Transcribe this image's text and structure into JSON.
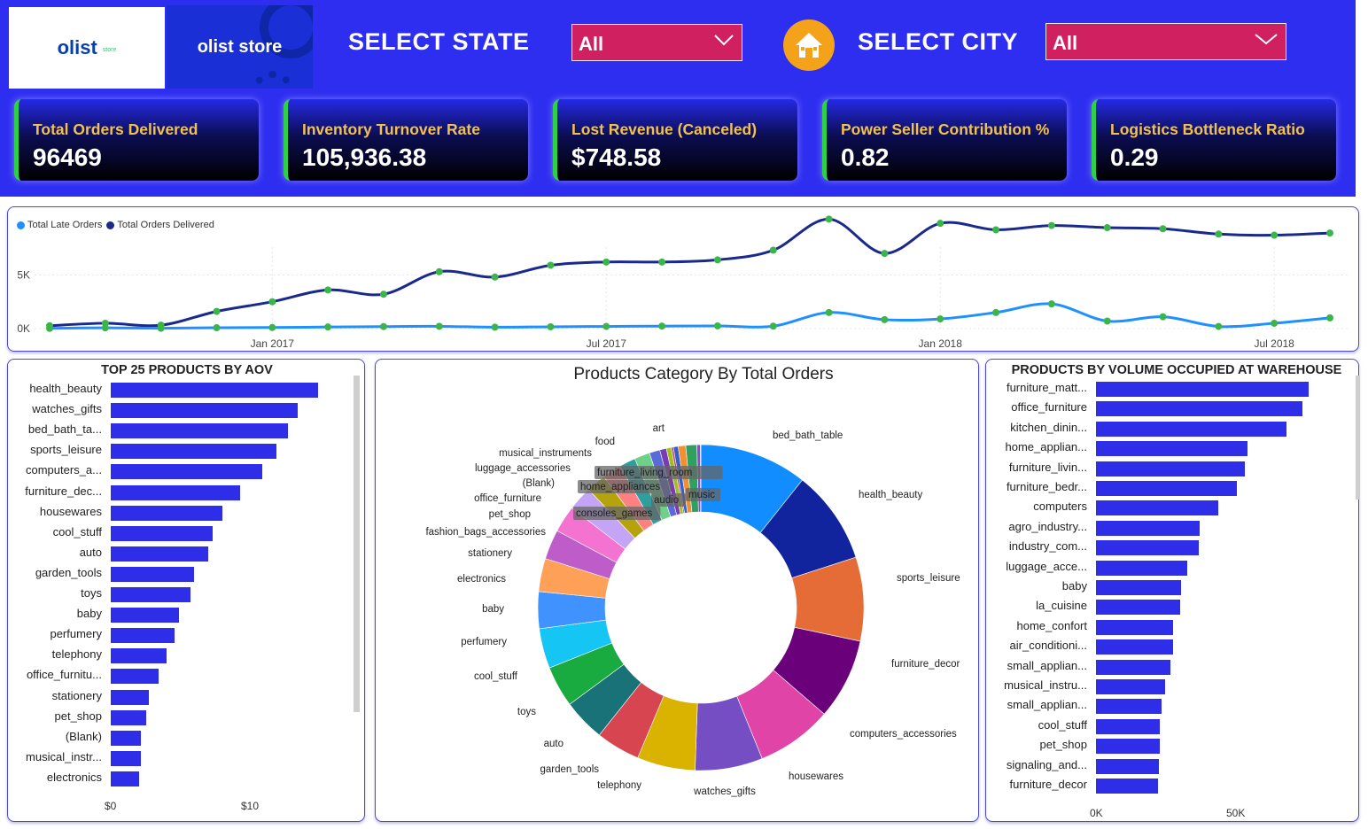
{
  "logos": {
    "olist": "olist",
    "olist_tag": "store",
    "olist_store": "olist store"
  },
  "filters": {
    "state_label": "SELECT STATE",
    "state_value": "All",
    "city_label": "SELECT CITY",
    "city_value": "All"
  },
  "kpis": [
    {
      "title": "Total Orders Delivered",
      "value": "96469"
    },
    {
      "title": "Inventory Turnover Rate",
      "value": "105,936.38"
    },
    {
      "title": "Lost Revenue (Canceled)",
      "value": "$748.58"
    },
    {
      "title": "Power Seller Contribution %",
      "value": "0.82"
    },
    {
      "title": "Logistics Bottleneck Ratio",
      "value": "0.29"
    }
  ],
  "colors": {
    "header": "#2e2ef0",
    "bar": "#2e2ee8",
    "late": "#1e90ff",
    "delivered": "#1a2a8c",
    "marker": "#3bb54a"
  },
  "chart_data": [
    {
      "type": "line",
      "legend": [
        "Total Late Orders",
        "Total Orders Delivered"
      ],
      "x": [
        "2016-10",
        "2016-12",
        "2017-01",
        "2017-02",
        "2017-03",
        "2017-04",
        "2017-05",
        "2017-06",
        "2017-07",
        "2017-08",
        "2017-09",
        "2017-10",
        "2017-11",
        "2017-12",
        "2018-01",
        "2018-02",
        "2018-03",
        "2018-04",
        "2018-05",
        "2018-06",
        "2018-07",
        "2018-08"
      ],
      "x_ticks": [
        "Jan 2017",
        "Jul 2017",
        "Jan 2018",
        "Jul 2018"
      ],
      "y_ticks": [
        "0K",
        "5K"
      ],
      "ylim": [
        0,
        8000
      ],
      "series": [
        {
          "name": "Total Orders Delivered",
          "values": [
            265,
            500,
            320,
            1600,
            2500,
            3600,
            3200,
            5300,
            4800,
            5900,
            6200,
            6200,
            6400,
            7300,
            10200,
            7000,
            9800,
            9200,
            9600,
            9400,
            9300,
            8800,
            8700,
            8900
          ]
        },
        {
          "name": "Total Late Orders",
          "values": [
            20,
            70,
            30,
            80,
            100,
            150,
            190,
            210,
            130,
            170,
            200,
            230,
            250,
            230,
            1500,
            830,
            900,
            1500,
            2300,
            700,
            1100,
            200,
            500,
            1000
          ]
        }
      ]
    },
    {
      "type": "bar",
      "title": "TOP 25 PRODUCTS BY AOV",
      "categories": [
        "health_beauty",
        "watches_gifts",
        "bed_bath_ta...",
        "sports_leisure",
        "computers_a...",
        "furniture_dec...",
        "housewares",
        "cool_stuff",
        "auto",
        "garden_tools",
        "toys",
        "baby",
        "perfumery",
        "telephony",
        "office_furnitu...",
        "stationery",
        "pet_shop",
        "(Blank)",
        "musical_instr...",
        "electronics"
      ],
      "values": [
        13.0,
        11.7,
        11.1,
        10.4,
        9.5,
        8.1,
        7.0,
        6.4,
        6.1,
        5.2,
        5.0,
        4.3,
        4.0,
        3.5,
        3.0,
        2.4,
        2.2,
        1.9,
        1.9,
        1.8
      ],
      "x_ticks": [
        "$0",
        "$10"
      ],
      "xlim": [
        0,
        15
      ]
    },
    {
      "type": "pie",
      "title": "Products Category By Total Orders",
      "labels": [
        "bed_bath_table",
        "health_beauty",
        "sports_leisure",
        "furniture_decor",
        "computers_accessories",
        "housewares",
        "watches_gifts",
        "telephony",
        "garden_tools",
        "auto",
        "toys",
        "cool_stuff",
        "perfumery",
        "baby",
        "electronics",
        "stationery",
        "fashion_bags_accessories",
        "pet_shop",
        "office_furniture",
        "(Blank)",
        "luggage_accessories",
        "musical_instruments",
        "food",
        "art",
        "furniture_living_room",
        "home_appliances",
        "consoles_games",
        "audio",
        "music"
      ],
      "values": [
        11115,
        9670,
        8641,
        8334,
        7827,
        6964,
        5991,
        4545,
        4347,
        4235,
        4117,
        3796,
        3419,
        3065,
        2767,
        2517,
        2031,
        1947,
        1691,
        1603,
        1092,
        680,
        510,
        209,
        503,
        771,
        1137,
        364,
        38
      ],
      "colors": [
        "#118dff",
        "#12239e",
        "#e66c37",
        "#6b007b",
        "#e044a7",
        "#744ec2",
        "#d9b300",
        "#d64550",
        "#197278",
        "#1aab40",
        "#15c6f4",
        "#4092ff",
        "#ffa058",
        "#be5dc9",
        "#f472d0",
        "#c4a5f5",
        "#b5a30e",
        "#ff8080",
        "#2f9e9e",
        "#6fd08a",
        "#5a6ad8",
        "#7a3bb5",
        "#a0c020",
        "#c83a72",
        "#3060c8",
        "#f09030",
        "#30a060",
        "#8050d0",
        "#d0d040"
      ]
    },
    {
      "type": "bar",
      "title": "PRODUCTS BY VOLUME OCCUPIED AT WAREHOUSE",
      "categories": [
        "furniture_matt...",
        "office_furniture",
        "kitchen_dinin...",
        "home_applian...",
        "furniture_livin...",
        "furniture_bedr...",
        "computers",
        "agro_industry...",
        "industry_com...",
        "luggage_acce...",
        "baby",
        "la_cuisine",
        "home_confort",
        "air_conditioni...",
        "small_applian...",
        "musical_instru...",
        "small_applian...",
        "cool_stuff",
        "pet_shop",
        "signaling_and...",
        "furniture_decor"
      ],
      "values": [
        77000,
        75000,
        69000,
        55000,
        54000,
        51000,
        44500,
        37500,
        37200,
        33000,
        31000,
        30500,
        28000,
        28000,
        27000,
        25000,
        23700,
        23200,
        23000,
        22700,
        22500
      ],
      "x_ticks": [
        "0K",
        "50K"
      ],
      "xlim": [
        0,
        90000
      ]
    }
  ]
}
